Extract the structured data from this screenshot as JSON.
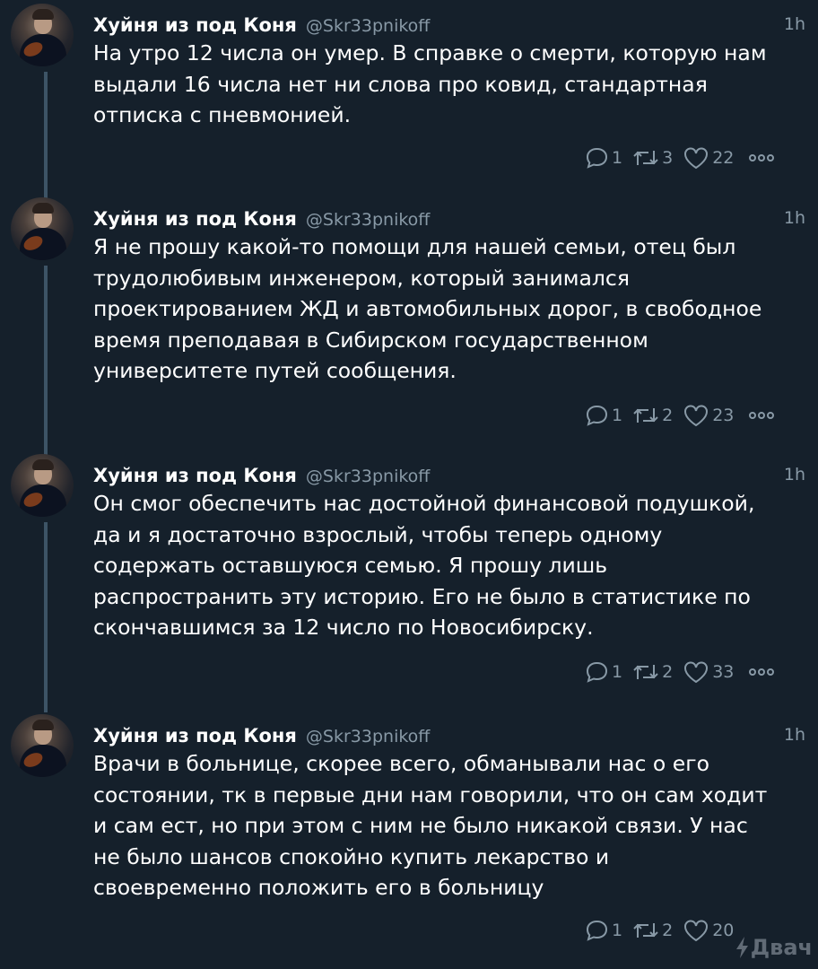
{
  "tweets": [
    {
      "name": "Хуйня из под Коня",
      "handle": "@Skr33pnikoff",
      "time": "1h",
      "text": "На утро 12 числа он умер. В справке о смерти, которую нам\nвыдали 16 числа нет ни слова про ковид, стандартная\nотписка с пневмонией.",
      "replies": "1",
      "retweets": "3",
      "likes": "22"
    },
    {
      "name": "Хуйня из под Коня",
      "handle": "@Skr33pnikoff",
      "time": "1h",
      "text": "Я не прошу какой-то помощи для нашей семьи, отец был\nтрудолюбивым инженером, который занимался\nпроектированием ЖД и автомобильных дорог, в свободное\nвремя преподавая в Сибирском государственном\nуниверситете путей сообщения.",
      "replies": "1",
      "retweets": "2",
      "likes": "23"
    },
    {
      "name": "Хуйня из под Коня",
      "handle": "@Skr33pnikoff",
      "time": "1h",
      "text": "Он смог обеспечить нас достойной финансовой подушкой,\nда и я достаточно взрослый, чтобы теперь одному\nсодержать оставшуюся семью. Я прошу лишь\nраспространить эту историю. Его не было в статистике по\nскончавшимся за 12 число по Новосибирску.",
      "replies": "1",
      "retweets": "2",
      "likes": "33"
    },
    {
      "name": "Хуйня из под Коня",
      "handle": "@Skr33pnikoff",
      "time": "1h",
      "text": "Врачи в больнице, скорее всего, обманывали нас о его\nсостоянии, тк в первые дни нам говорили, что он сам ходит\nи сам ест, но при этом с ним не было никакой связи. У нас\nне было шансов спокойно купить лекарство и\nсвоевременно положить его в больницу",
      "replies": "1",
      "retweets": "2",
      "likes": "20"
    }
  ],
  "watermark": "Двач",
  "colors": {
    "background": "#15202b",
    "secondary_text": "#8899a6",
    "thread_line": "#3d5466"
  },
  "icons": [
    "reply-icon",
    "retweet-icon",
    "like-icon",
    "more-icon"
  ]
}
